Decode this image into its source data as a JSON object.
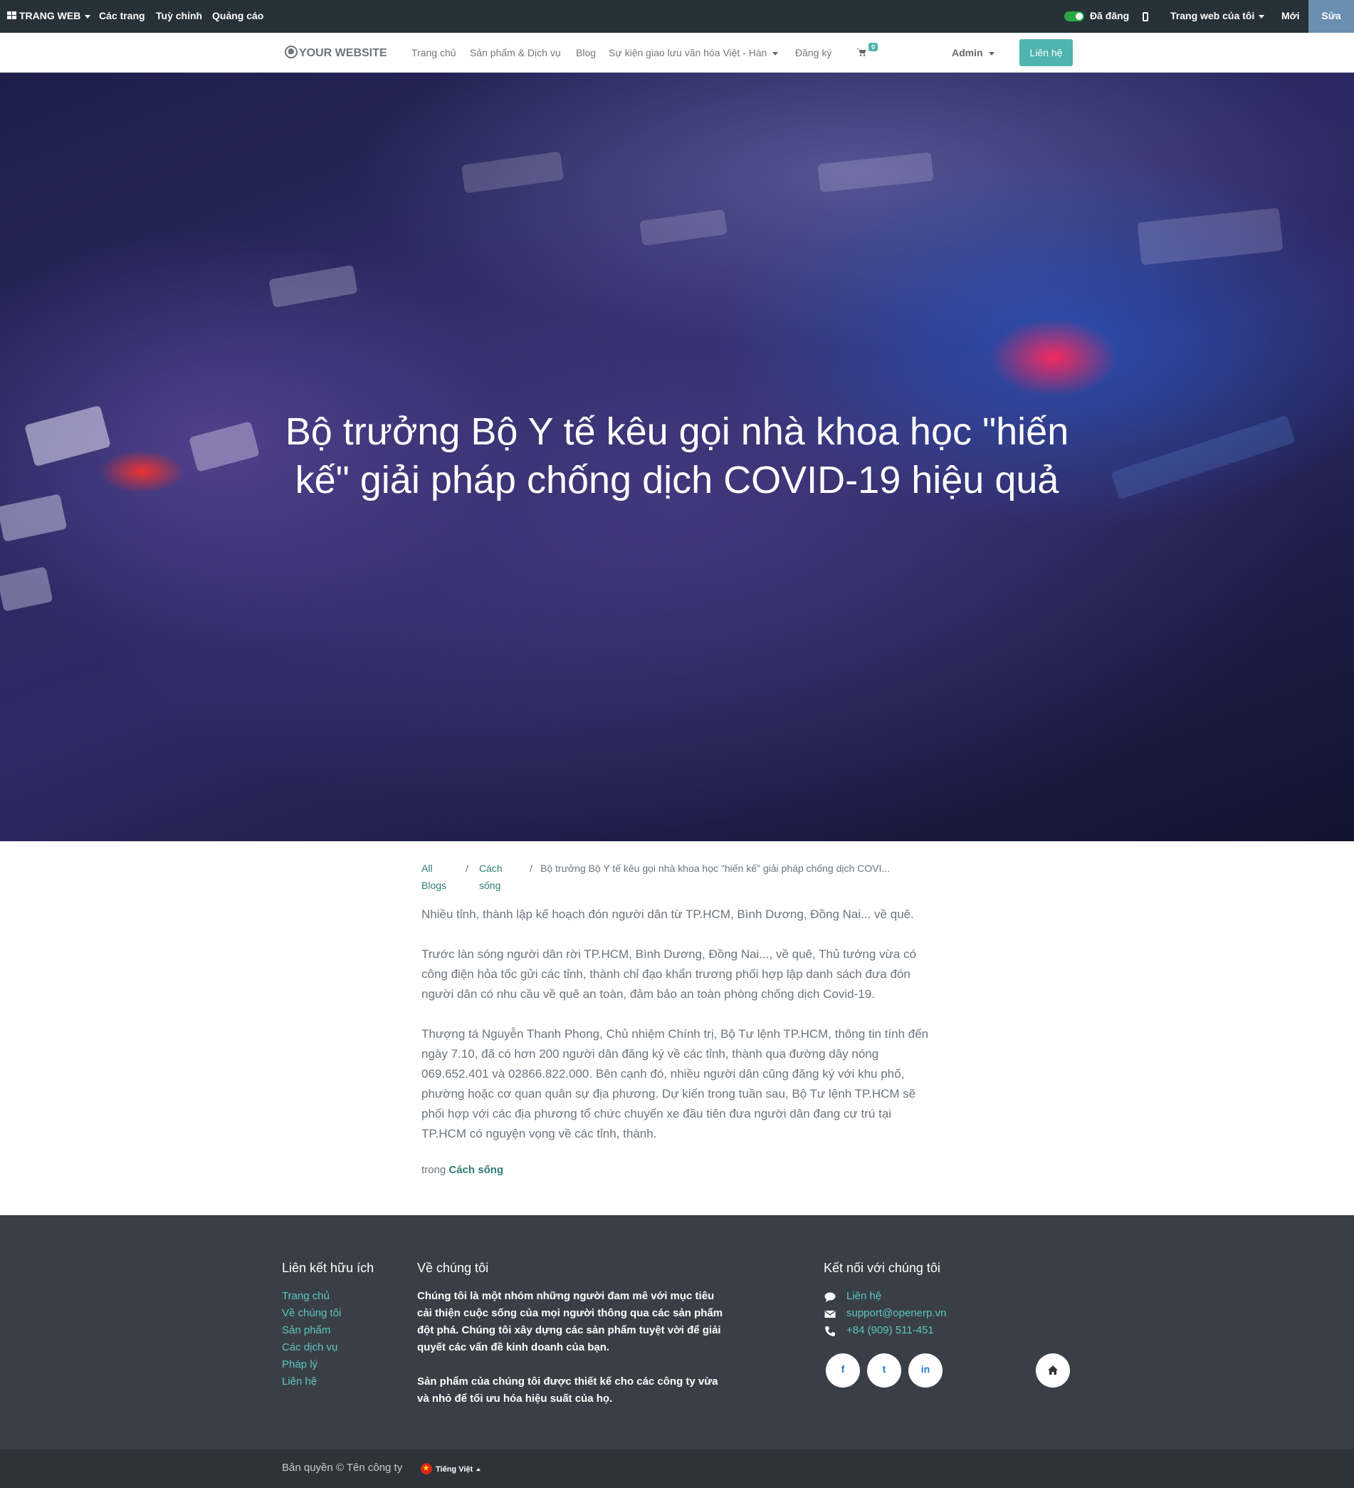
{
  "admin_bar": {
    "website_menu": "TRANG WEB",
    "pages": "Các trang",
    "customize": "Tuỳ chỉnh",
    "promote": "Quảng cáo",
    "published": "Đã đăng",
    "my_website": "Trang web của tôi",
    "new": "Mới",
    "edit": "Sửa"
  },
  "navbar": {
    "brand": "YOUR WEBSITE",
    "links": [
      "Trang chủ",
      "Sản phẩm & Dịch vụ",
      "Blog",
      "Sự kiện giao lưu văn hóa Việt - Hàn",
      "Đăng ký"
    ],
    "cart_count": "0",
    "user": "Admin",
    "contact": "Liên hệ"
  },
  "hero": {
    "title": "Bộ trưởng Bộ Y tế kêu gọi nhà khoa học \"hiến kế\" giải pháp chống dịch COVID-19 hiệu quả"
  },
  "breadcrumb": {
    "all_blogs_1": "All",
    "all_blogs_2": "Blogs",
    "sep": "/",
    "category_1": "Cách",
    "category_2": "sống",
    "current": "Bộ trưởng Bộ Y tế kêu gọi nhà khoa học \"hiến kế\" giải pháp chống dịch COVI..."
  },
  "article": {
    "paragraphs": [
      "Nhiều tỉnh, thành lập kế hoạch đón người dân từ TP.HCM, Bình Dương, Đồng Nai... về quê.",
      "Trước làn sóng người dân rời TP.HCM, Bình Dương, Đồng Nai..., về quê, Thủ tướng vừa có công điện hỏa tốc gửi các tỉnh, thành chỉ đạo khẩn trương phối hợp lập danh sách đưa đón người dân có nhu cầu về quê an toàn, đảm bảo an toàn phòng chống dịch Covid-19.",
      "Thượng tá Nguyễn Thanh Phong, Chủ nhiệm Chính trị, Bộ Tư lệnh TP.HCM, thông tin tính đến ngày 7.10, đã có hơn 200 người dân đăng ký về các tỉnh, thành qua đường dây nóng 069.652.401 và 02866.822.000. Bên cạnh đó, nhiều người dân cũng đăng ký với khu phố, phường hoặc cơ quan quân sự địa phương. Dự kiến trong tuần sau, Bộ Tư lệnh TP.HCM sẽ phối hợp với các địa phương tổ chức chuyến xe đầu tiên đưa người dân đang cư trú tại TP.HCM có nguyện vọng về các tỉnh, thành."
    ],
    "in_label": "trong",
    "category": "Cách sống"
  },
  "footer": {
    "links_title": "Liên kết hữu ích",
    "links": [
      "Trang chủ",
      "Về chúng tôi",
      "Sản phẩm",
      "Các dịch vụ",
      "Pháp lý",
      "Liên hệ"
    ],
    "about_title": "Về chúng tôi",
    "about_p1": "Chúng tôi là một nhóm những người đam mê với mục tiêu cải thiện cuộc sống của mọi người thông qua các sản phẩm đột phá. Chúng tôi xây dựng các sản phẩm tuyệt vời để giải quyết các vấn đề kinh doanh của bạn.",
    "about_p2": "Sản phẩm của chúng tôi được thiết kế cho các công ty vừa và nhỏ để tối ưu hóa hiệu suất của họ.",
    "connect_title": "Kết nối với chúng tôi",
    "contact": "Liên hệ",
    "email": "support@openerp.vn",
    "phone": "+84 (909) 511-451",
    "social": {
      "facebook": "f",
      "twitter": "t",
      "linkedin": "in"
    }
  },
  "copyright": {
    "text": "Bản quyền © Tên công ty",
    "language": "Tiếng Việt"
  },
  "colors": {
    "accent": "#4fb4ad",
    "admin_bar": "#263238",
    "footer": "#3a3f47",
    "edit_button": "#6b8fb1"
  }
}
